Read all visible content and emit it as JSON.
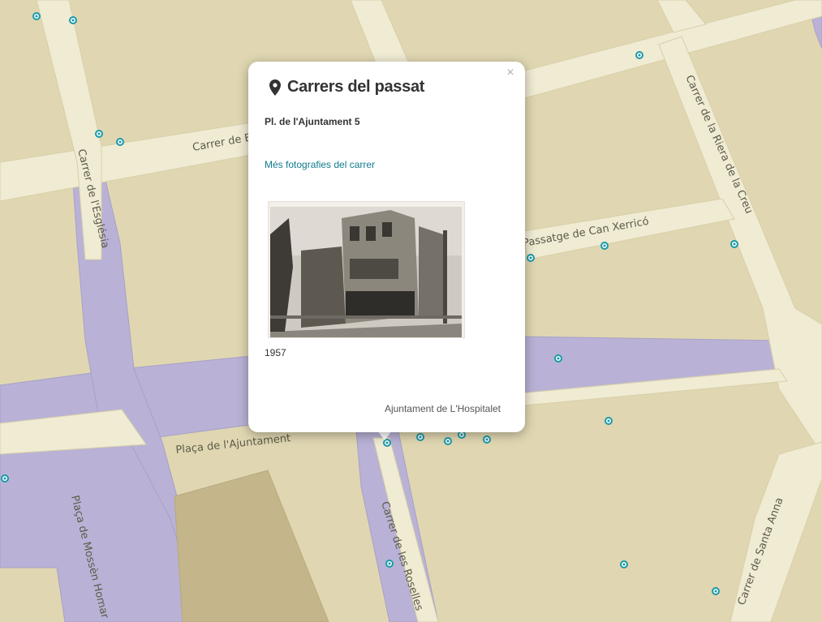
{
  "map": {
    "street_labels": [
      "Carrer de Be",
      "Carrer de l'Església",
      "Carrer de la Riera de la Creu",
      "Passatge de Can Xerricó",
      "Plaça de l'Ajuntament",
      "Plaça de Mossèn Homar",
      "Carrer de les Roselles",
      "Carrer de Santa Anna"
    ],
    "colors": {
      "block": "#e0d7b2",
      "street": "#f0ebd3",
      "pedestrian": "#b9b2d6",
      "block_outline": "#cfc59c",
      "marker": "#1a9aa8"
    }
  },
  "popup": {
    "title": "Carrers del passat",
    "close_label": "×",
    "address": "Pl. de l'Ajuntament 5",
    "more_link": "Més fotografies del carrer",
    "photo_year": "1957",
    "credit": "Ajuntament de L'Hospitalet",
    "icons": {
      "title": "map-marker-icon",
      "close": "close-icon"
    }
  }
}
